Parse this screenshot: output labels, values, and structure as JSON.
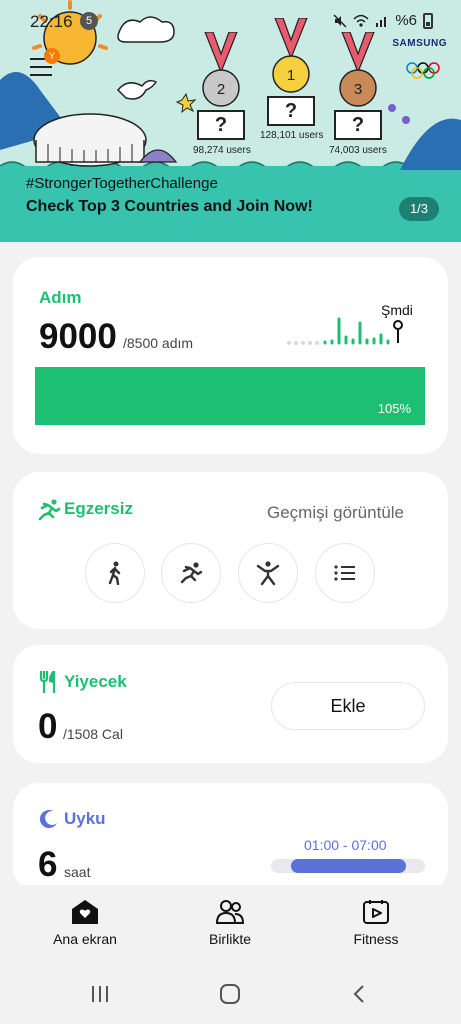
{
  "status_bar": {
    "time": "22:16",
    "notification_count": "5",
    "battery": "%6"
  },
  "banner": {
    "brand": "SAMSUNG",
    "medals": [
      {
        "rank": "2",
        "users": "98,274 users"
      },
      {
        "rank": "1",
        "users": "128,101 users"
      },
      {
        "rank": "3",
        "users": "74,003 users"
      }
    ],
    "question_mark": "?",
    "hamburger_badge": "Y",
    "hashtag": "#StrongerTogetherChallenge",
    "title": "Check Top 3 Countries and Join Now!",
    "page_indicator": "1/3",
    "colors": {
      "band": "#37c3ad",
      "indicator": "#1f7f73"
    }
  },
  "steps": {
    "title": "Adım",
    "value": "9000",
    "target": "/8500 adım",
    "now_label": "Şmdi",
    "progress_label": "105%",
    "progress_fraction": 1.05
  },
  "exercise": {
    "title": "Egzersiz",
    "history_link": "Geçmişi görüntüle",
    "buttons": [
      "walk-icon",
      "run-icon",
      "workout-icon",
      "list-icon"
    ]
  },
  "food": {
    "title": "Yiyecek",
    "value": "0",
    "target": "/1508 Cal",
    "add_label": "Ekle"
  },
  "sleep": {
    "title": "Uyku",
    "value": "6",
    "unit": "saat",
    "range": "01:00 - 07:00"
  },
  "bottom_nav": {
    "items": [
      {
        "label": "Ana ekran",
        "icon": "home-icon"
      },
      {
        "label": "Birlikte",
        "icon": "people-icon"
      },
      {
        "label": "Fitness",
        "icon": "fitness-icon"
      }
    ]
  },
  "colors": {
    "accent": "#1dbf73",
    "sleep": "#5b72d8"
  }
}
